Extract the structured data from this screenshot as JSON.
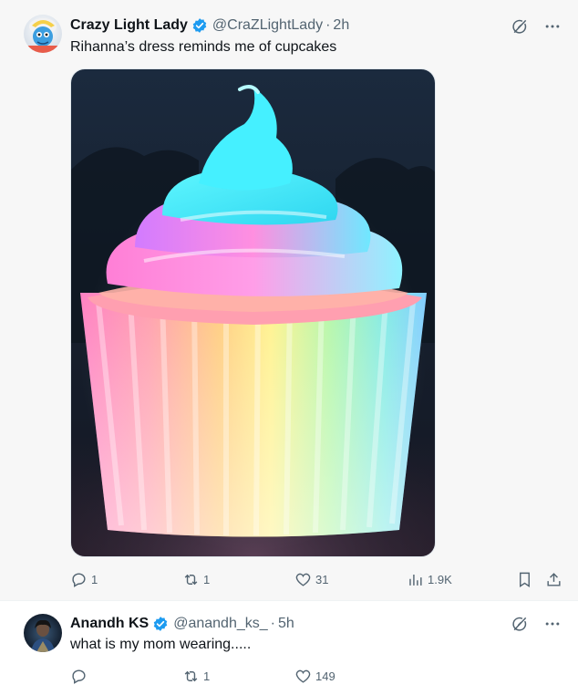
{
  "tweets": [
    {
      "author": {
        "name": "Crazy Light Lady",
        "handle": "@CraZLightLady",
        "time": "2h"
      },
      "text": "Rihanna’s dress reminds me of cupcakes",
      "media": {
        "description_icon": "cupcake-image"
      },
      "stats": {
        "replies": "1",
        "reposts": "1",
        "likes": "31",
        "views": "1.9K"
      }
    },
    {
      "author": {
        "name": "Anandh KS",
        "handle": "@anandh_ks_",
        "time": "5h"
      },
      "text": "what is my mom wearing.....",
      "stats": {
        "replies": "",
        "reposts": "1",
        "likes": "149"
      }
    }
  ],
  "separator": "·",
  "colors": {
    "verified": "#1d9bf0",
    "secondary_text": "#536471",
    "primary_text": "#0f1419"
  }
}
